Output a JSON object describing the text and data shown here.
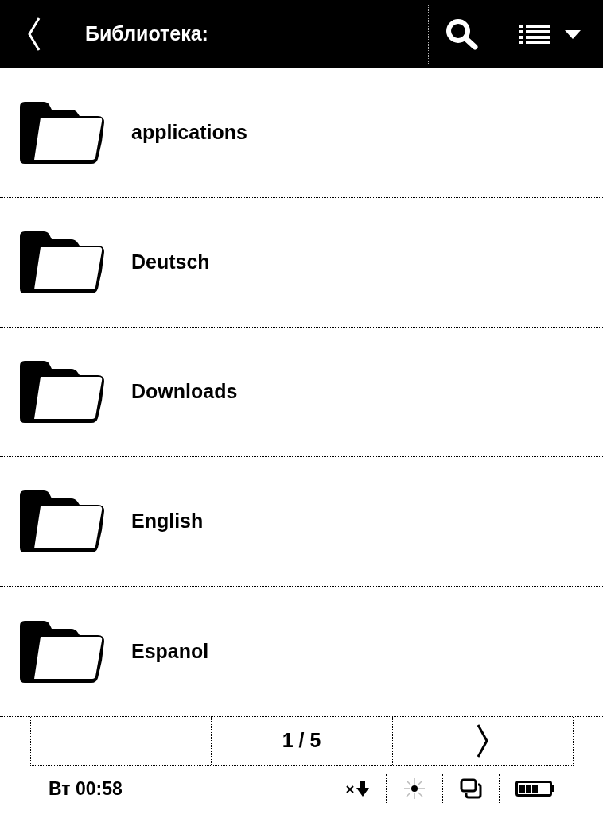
{
  "header": {
    "title": "Библиотека:"
  },
  "folders": [
    {
      "name": "applications"
    },
    {
      "name": "Deutsch"
    },
    {
      "name": "Downloads"
    },
    {
      "name": "English"
    },
    {
      "name": "Espanol"
    }
  ],
  "pagination": {
    "page": "1 / 5"
  },
  "status_bar": {
    "clock": "Вт 00:58"
  }
}
